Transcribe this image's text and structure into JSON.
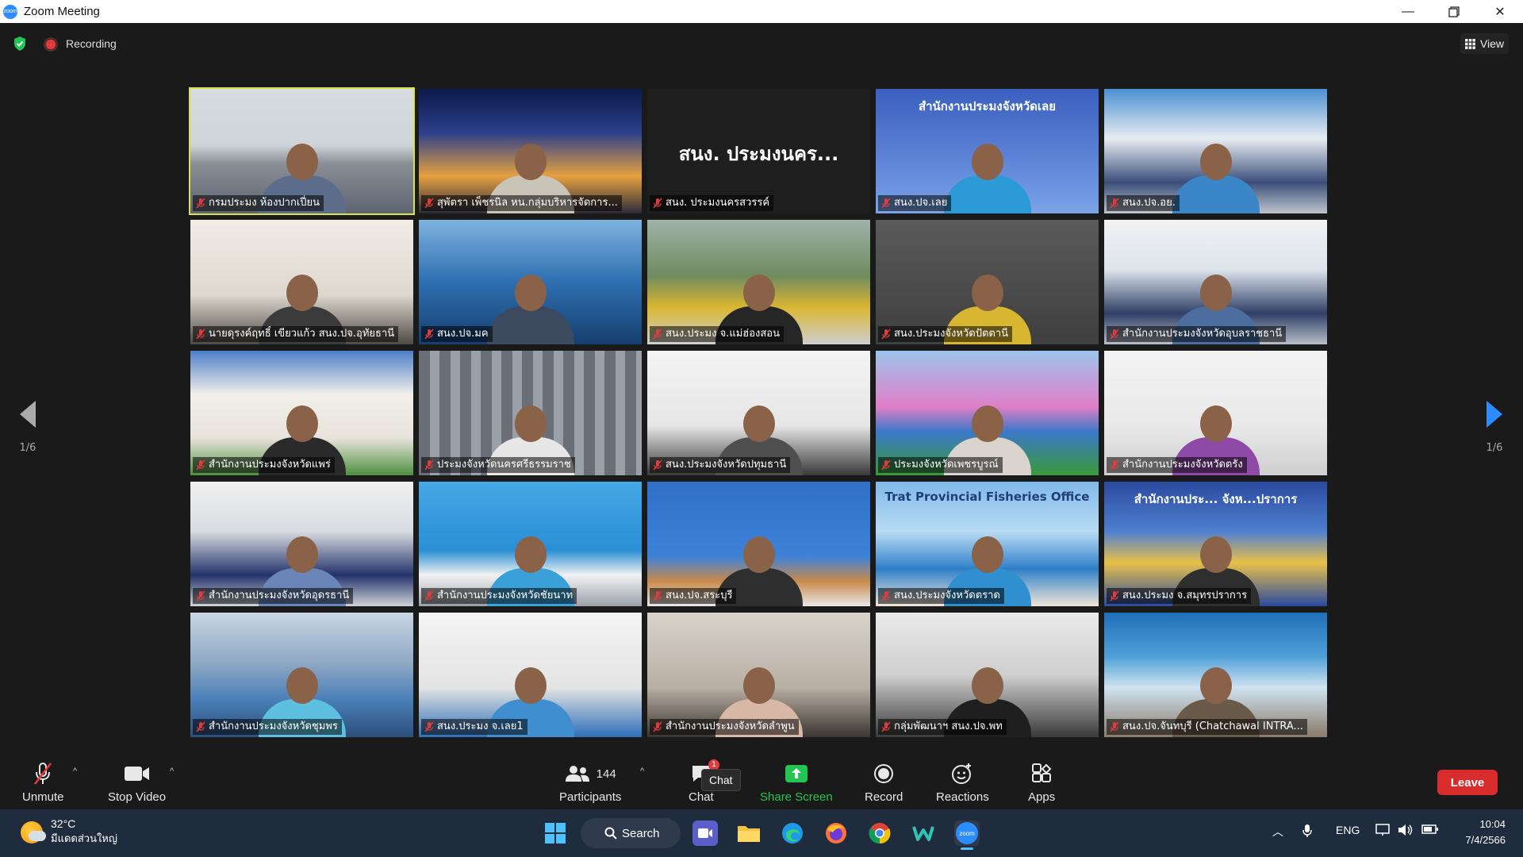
{
  "window": {
    "title": "Zoom Meeting"
  },
  "topbar": {
    "recording_label": "Recording",
    "view_label": "View"
  },
  "pager": {
    "left": "1/6",
    "right": "1/6"
  },
  "tiles": [
    {
      "name": "กรมประมง ห้องปากเปี่ยน",
      "active": true,
      "bg": "conference",
      "shirt": "#5b6d8a"
    },
    {
      "name": "สุพัตรา เพ็ชรนิล  หน.กลุ่มบริหารจัดการ...",
      "bg": "sunset",
      "shirt": "#c9c4b8"
    },
    {
      "name": "สนง. ประมงนครสวรรค์",
      "bg": "dark",
      "text": "สนง. ประมงนคร..."
    },
    {
      "name": "สนง.ปจ.เลย",
      "bg": "banner",
      "banner": "สำนักงานประมงจังหวัดเลย",
      "shirt": "#2c9ad6"
    },
    {
      "name": "สนง.ปจ.อย.",
      "bg": "meetroom",
      "shirt": "#3a86c8"
    },
    {
      "name": "นายดุรงค์ฤทธิ์ เขียวแก้ว สนง.ปจ.อุทัยธานี",
      "bg": "office",
      "shirt": "#3b3b3b"
    },
    {
      "name": "สนง.ปจ.มค",
      "bg": "ocean",
      "shirt": "#3b4a5f"
    },
    {
      "name": "สนง.ประมง จ.แม่ฮ่องสอน",
      "bg": "temple",
      "shirt": "#262626"
    },
    {
      "name": "สนง.ประมงจังหวัดปัตตานี",
      "bg": "plain",
      "shirt": "#d9b632"
    },
    {
      "name": "สำนักงานประมงจังหวัดอุบลราชธานี",
      "bg": "meetroom2",
      "shirt": "#4b6e9f"
    },
    {
      "name": "สำนักงานประมงจังหวัดแพร่",
      "bg": "building",
      "shirt": "#2a2a2a"
    },
    {
      "name": "ประมงจังหวัดนครศรีธรรมราช",
      "bg": "curtain",
      "shirt": "#e7e7e7"
    },
    {
      "name": "สนง.ประมงจังหวัดปทุมธานี",
      "bg": "wall",
      "shirt": "#4f4f4f"
    },
    {
      "name": "ประมงจังหวัดเพชรบูรณ์",
      "bg": "garden",
      "shirt": "#d8d3cc"
    },
    {
      "name": "สำนักงานประมงจังหวัดตรัง",
      "bg": "whiteroom",
      "shirt": "#8e4aa6"
    },
    {
      "name": "สำนักงานประมงจังหวัดอุดรธานี",
      "bg": "room2",
      "shirt": "#6a86b8"
    },
    {
      "name": "สำนักงานประมงจังหวัดชัยนาท",
      "bg": "blue-curtain",
      "shirt": "#3aa0d8"
    },
    {
      "name": "สนง.ปจ.สระบุรี",
      "bg": "bluewall",
      "shirt": "#2f2f2f"
    },
    {
      "name": "สนง.ประมงจังหวัดตราด",
      "bg": "seabanner",
      "banner": "Trat Provincial Fisheries Office",
      "shirt": "#2f8fcf"
    },
    {
      "name": "สนง.ประมง จ.สมุทรปราการ",
      "bg": "banner2",
      "banner": "สำนักงานประ... จังห...ปราการ",
      "shirt": "#2e2e2e"
    },
    {
      "name": "สำนักงานประมงจังหวัดชุมพร",
      "bg": "office2",
      "shirt": "#5ec0e0"
    },
    {
      "name": "สนง.ประมง จ.เลย1",
      "bg": "cubicle",
      "shirt": "#3f8fd0"
    },
    {
      "name": "สำนักงานประมงจังหวัดลำพูน",
      "bg": "plain2",
      "shirt": "#d8b9a8"
    },
    {
      "name": "กลุ่มพัฒนาฯ สนง.ปจ.พท",
      "bg": "shelf",
      "shirt": "#1f1f1f"
    },
    {
      "name": "สนง.ปจ.จันทบุรี (Chatchawal INTRA...",
      "bg": "banner3",
      "shirt": "#6a5a4a"
    }
  ],
  "toolbar": {
    "unmute": "Unmute",
    "stop_video": "Stop Video",
    "participants_count": "144",
    "participants": "Participants",
    "chat": "Chat",
    "chat_tip": "Chat",
    "chat_badge": "1",
    "share": "Share Screen",
    "record": "Record",
    "reactions": "Reactions",
    "apps": "Apps",
    "leave": "Leave"
  },
  "taskbar": {
    "temp": "32°C",
    "weather": "มีแดดส่วนใหญ่",
    "search": "Search",
    "lang": "ENG",
    "time": "10:04",
    "date": "7/4/2566"
  },
  "colors": {
    "active_outline": "#d6e34a",
    "share_green": "#23c552",
    "leave_red": "#d92d2d",
    "zoom_blue": "#2d8cff"
  }
}
